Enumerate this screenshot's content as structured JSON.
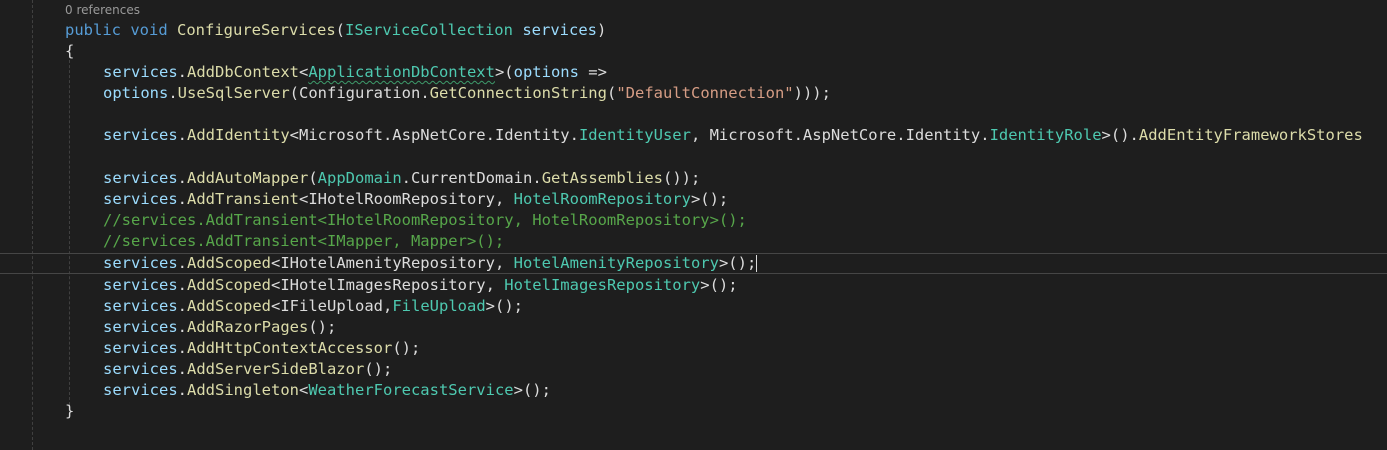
{
  "codelens": "0 references",
  "code": {
    "l1": {
      "public": "public",
      "void": "void",
      "method": "ConfigureServices",
      "open": "(",
      "type": "IServiceCollection",
      "param": "services",
      "close": ")"
    },
    "l2": "{",
    "l3": {
      "services": "services",
      "dot": ".",
      "method": "AddDbContext",
      "lt": "<",
      "type": "ApplicationDbContext",
      "rest1": ">(",
      "param": "options",
      "rest2": " =>"
    },
    "l4": {
      "param": "options",
      "dot1": ".",
      "method": "UseSqlServer",
      "p1": "(",
      "cfg": "Configuration",
      "dot2": ".",
      "method2": "GetConnectionString",
      "p2": "(",
      "str": "\"DefaultConnection\"",
      "p3": ")));"
    },
    "l5": {
      "services": "services",
      "dot": ".",
      "method": "AddIdentity",
      "lt": "<Microsoft.AspNetCore.Identity.",
      "type1": "IdentityUser",
      "mid": ", Microsoft.AspNetCore.Identity.",
      "type2": "IdentityRole",
      "rest": ">().",
      "method2": "AddEntityFrameworkStores"
    },
    "l6": {
      "services": "services",
      "dot": ".",
      "method": "AddAutoMapper",
      "p1": "(",
      "type": "AppDomain",
      "dot2": ".",
      "prop": "CurrentDomain",
      "dot3": ".",
      "method2": "GetAssemblies",
      "p2": "());"
    },
    "l7": {
      "services": "services",
      "dot": ".",
      "method": "AddTransient",
      "lt": "<IHotelRoomRepository, ",
      "type": "HotelRoomRepository",
      "rest": ">();"
    },
    "l8": "//services.AddTransient<IHotelRoomRepository, HotelRoomRepository>();",
    "l9": "//services.AddTransient<IMapper, Mapper>();",
    "l10": {
      "services": "services",
      "dot": ".",
      "method": "AddScoped",
      "lt": "<IHotelAmenityRepository, ",
      "type": "HotelAmenityRepository",
      "rest": ">();"
    },
    "l11": {
      "services": "services",
      "dot": ".",
      "method": "AddScoped",
      "lt": "<IHotelImagesRepository, ",
      "type": "HotelImagesRepository",
      "rest": ">();"
    },
    "l12": {
      "services": "services",
      "dot": ".",
      "method": "AddScoped",
      "lt": "<IFileUpload,",
      "type": "FileUpload",
      "rest": ">();"
    },
    "l13": {
      "services": "services",
      "dot": ".",
      "method": "AddRazorPages",
      "rest": "();"
    },
    "l14": {
      "services": "services",
      "dot": ".",
      "method": "AddHttpContextAccessor",
      "rest": "();"
    },
    "l15": {
      "services": "services",
      "dot": ".",
      "method": "AddServerSideBlazor",
      "rest": "();"
    },
    "l16": {
      "services": "services",
      "dot": ".",
      "method": "AddSingleton",
      "lt": "<",
      "type": "WeatherForecastService",
      "rest": ">();"
    },
    "l17": "}"
  },
  "colors": {
    "background": "#1e1e1e",
    "keyword": "#569cd6",
    "method": "#dcdcaa",
    "type": "#4ec9b0",
    "parameter": "#9cdcfe",
    "string": "#d69d85",
    "comment": "#57a64a"
  }
}
